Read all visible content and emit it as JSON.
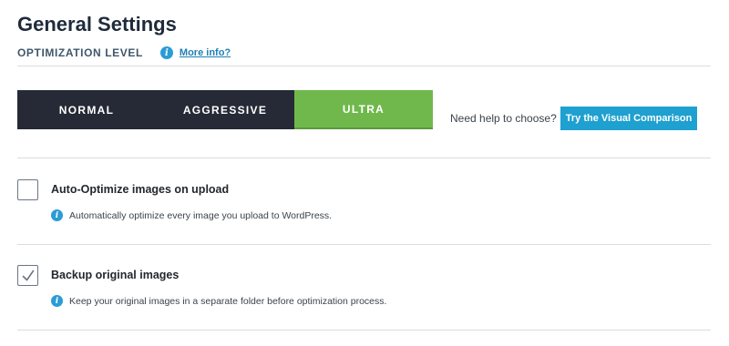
{
  "header": {
    "title": "General Settings",
    "section_label": "OPTIMIZATION LEVEL",
    "more_info": "More info?"
  },
  "levels": {
    "items": [
      "NORMAL",
      "AGGRESSIVE",
      "ULTRA"
    ],
    "selected": "ULTRA"
  },
  "help": {
    "text": "Need help to choose?",
    "button": "Try the Visual Comparison"
  },
  "options": [
    {
      "label": "Auto-Optimize images on upload",
      "description": "Automatically optimize every image you upload to WordPress.",
      "checked": false
    },
    {
      "label": "Backup original images",
      "description": "Keep your original images in a separate folder before optimization process.",
      "checked": true
    }
  ],
  "icons": {
    "info": "info-icon",
    "check": "checkmark-icon"
  },
  "colors": {
    "accent_green": "#70b84c",
    "dark_button": "#252a36",
    "info_blue": "#2a9cd6",
    "compare_button": "#1ea0d0",
    "link": "#1e80b4"
  }
}
